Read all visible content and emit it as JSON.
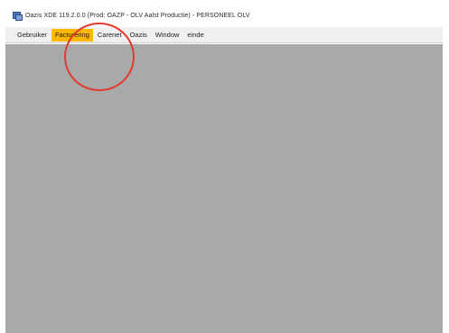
{
  "window": {
    "title": "Oazis XDE 119.2.0.0 (Prod: OAZP - OLV Aalst Productie) - PERSONEEL OLV",
    "icon": "app-window-icon"
  },
  "menubar": {
    "items": [
      {
        "label": "Gebruiker",
        "highlighted": false
      },
      {
        "label": "Facturering",
        "highlighted": true
      },
      {
        "label": "Carenet",
        "highlighted": false
      },
      {
        "label": "Oazis",
        "highlighted": false
      },
      {
        "label": "Window",
        "highlighted": false
      },
      {
        "label": "einde",
        "highlighted": false
      }
    ],
    "highlight_color": "#ffb800"
  },
  "workspace": {
    "background_color": "#a9a9a9"
  },
  "annotation": {
    "shape": "circle",
    "color": "#e23a2e",
    "target": "Facturering"
  }
}
